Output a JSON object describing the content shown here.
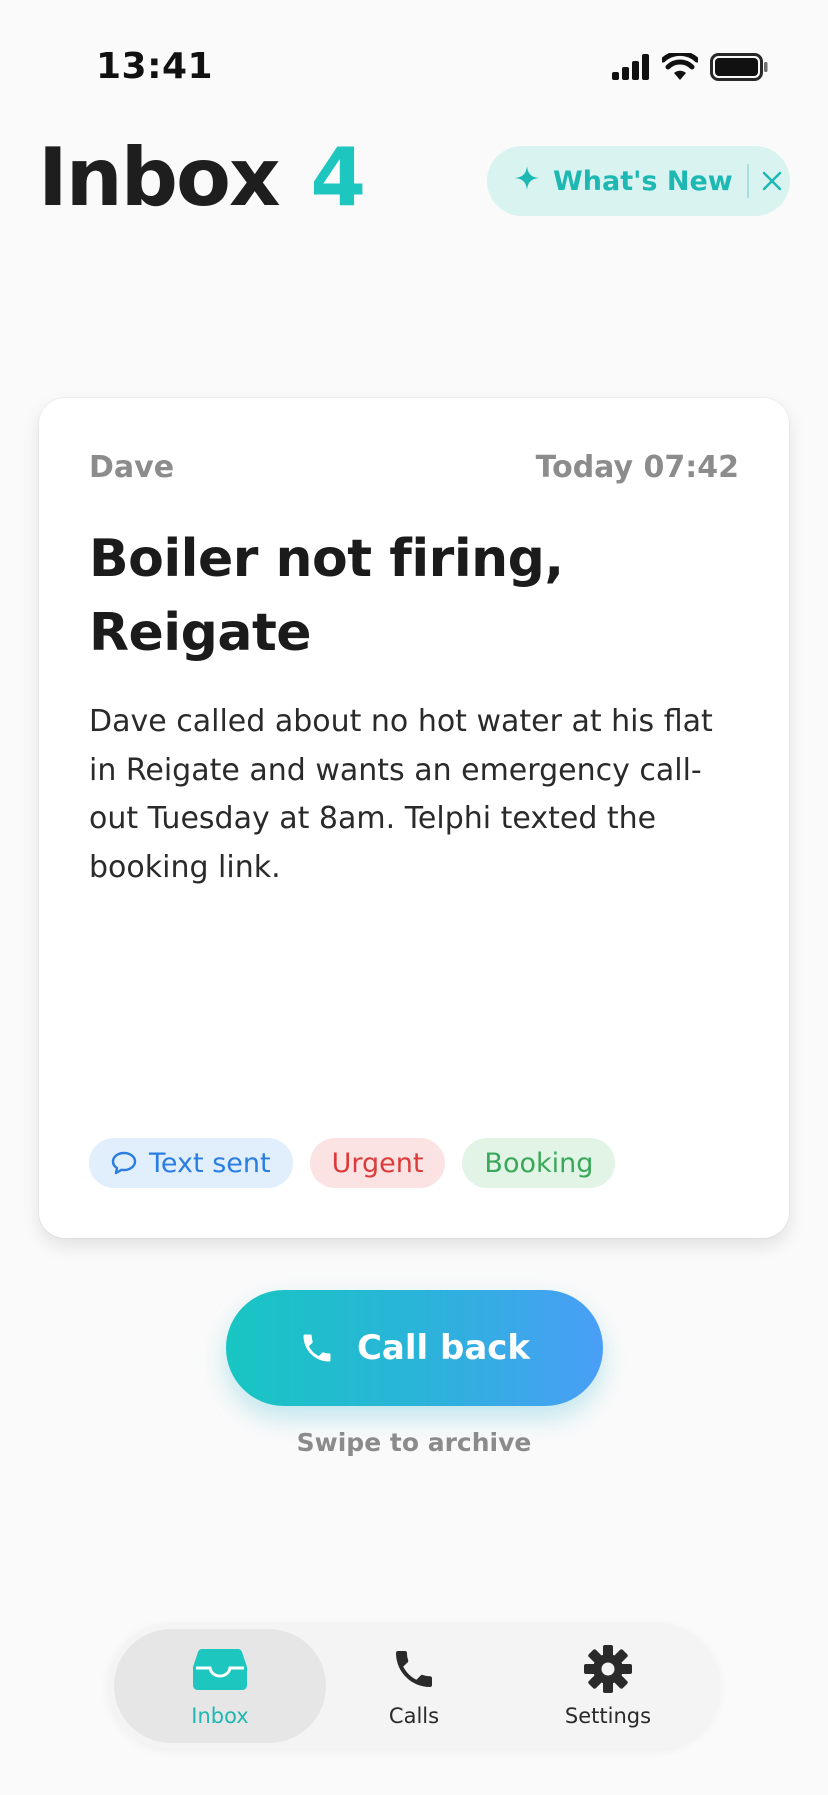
{
  "status_bar": {
    "time": "13:41"
  },
  "header": {
    "title": "Inbox",
    "count": "4",
    "whats_new_label": "What's New"
  },
  "card": {
    "caller": "Dave",
    "timestamp": "Today 07:42",
    "title": "Boiler not firing, Reigate",
    "summary": "Dave called about no hot water at his flat in Reigate and wants an emergency call-out Tuesday at 8am. Telphi texted the booking link.",
    "tags": [
      {
        "label": "Text sent",
        "color": "#2a7de1"
      },
      {
        "label": "Urgent",
        "color": "#db3b3b"
      },
      {
        "label": "Booking",
        "color": "#3aa85a"
      }
    ]
  },
  "actions": {
    "call_back_label": "Call back",
    "swipe_hint": "Swipe to archive"
  },
  "tab_bar": {
    "items": [
      {
        "label": "Inbox",
        "icon": "inbox-icon",
        "active": true
      },
      {
        "label": "Calls",
        "icon": "phone-icon",
        "active": false
      },
      {
        "label": "Settings",
        "icon": "gear-icon",
        "active": false
      }
    ]
  },
  "colors": {
    "accent": "#1ec6c0",
    "gradient_end": "#4a9ef7"
  }
}
